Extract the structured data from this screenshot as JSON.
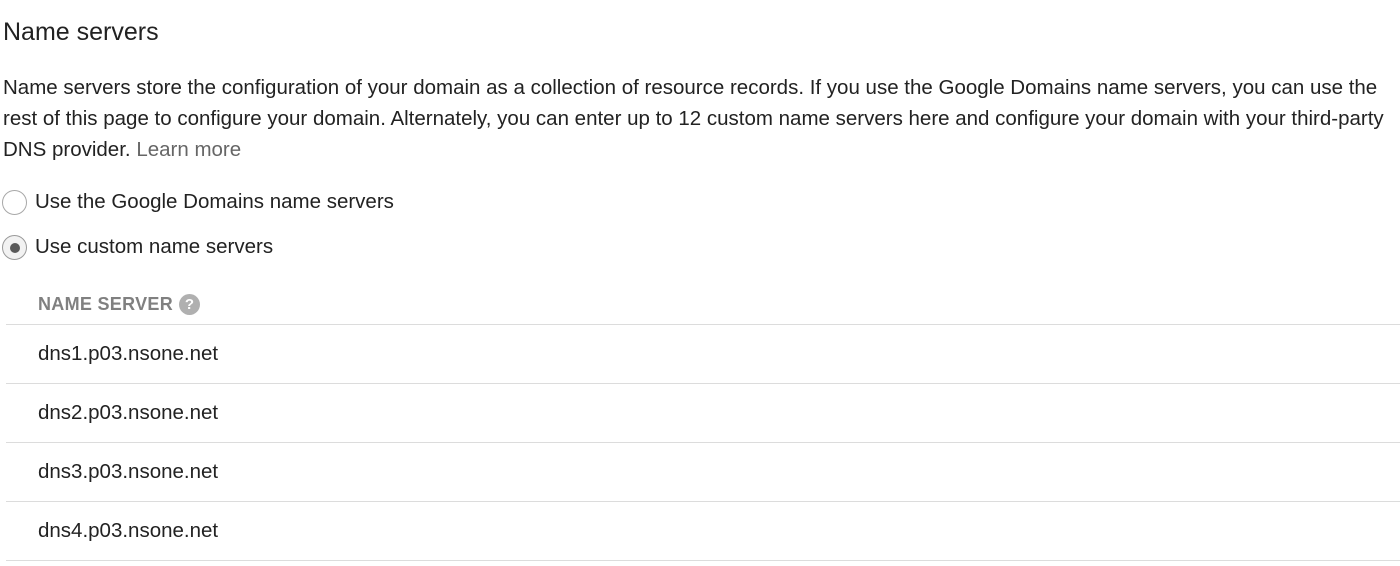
{
  "section": {
    "title": "Name servers",
    "description": "Name servers store the configuration of your domain as a collection of resource records. If you use the Google Domains name servers, you can use the rest of this page to configure your domain. Alternately, you can enter up to 12 custom name servers here and configure your domain with your third-party DNS provider.",
    "learn_more": "Learn more"
  },
  "options": [
    {
      "label": "Use the Google Domains name servers",
      "selected": false
    },
    {
      "label": "Use custom name servers",
      "selected": true
    }
  ],
  "table": {
    "header": "NAME SERVER",
    "help_icon": "question-circle-icon",
    "help_glyph": "?",
    "rows": [
      "dns1.p03.nsone.net",
      "dns2.p03.nsone.net",
      "dns3.p03.nsone.net",
      "dns4.p03.nsone.net"
    ]
  }
}
